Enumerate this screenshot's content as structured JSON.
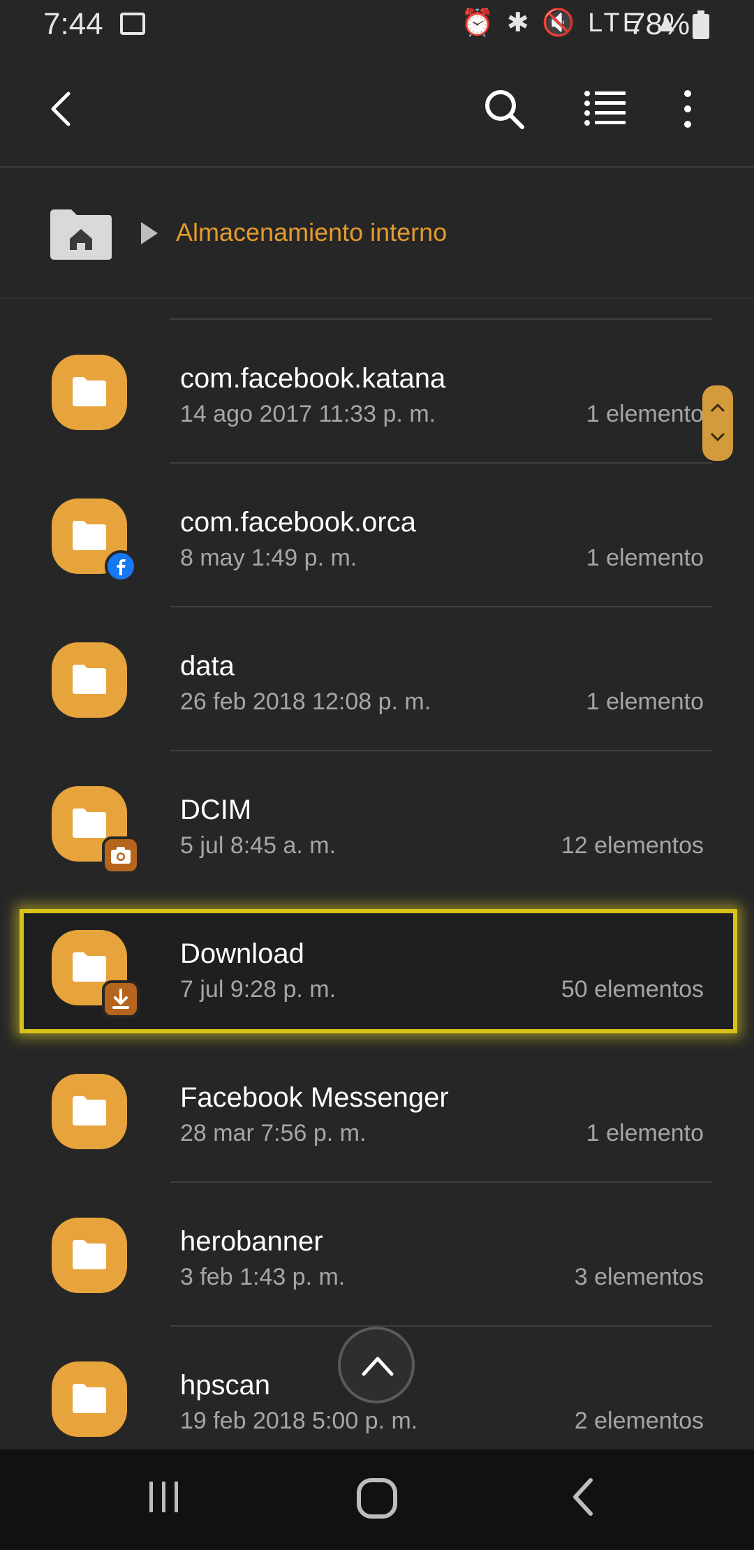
{
  "status_bar": {
    "time": "7:44",
    "status_icons": "⏰ ✱ 🔇 LTE ▲",
    "battery": "78%"
  },
  "app_bar": {
    "back_icon": "back-arrow-icon",
    "search_icon": "search-icon",
    "list_view_icon": "list-view-icon",
    "more_icon": "more-vert-icon"
  },
  "breadcrumb": {
    "home_icon": "home-folder-icon",
    "current": "Almacenamiento interno"
  },
  "colors": {
    "accent": "#e39b2e",
    "folder": "#e8a43c",
    "highlight": "#d8c21a",
    "background": "#262626"
  },
  "folders": [
    {
      "name": "com.facebook.katana",
      "date": "14 ago 2017 11:33 p. m.",
      "count": "1 elemento",
      "badge": null
    },
    {
      "name": "com.facebook.orca",
      "date": "8 may 1:49 p. m.",
      "count": "1 elemento",
      "badge": "facebook-icon"
    },
    {
      "name": "data",
      "date": "26 feb 2018 12:08 p. m.",
      "count": "1 elemento",
      "badge": null
    },
    {
      "name": "DCIM",
      "date": "5 jul 8:45 a. m.",
      "count": "12 elementos",
      "badge": "camera-icon"
    },
    {
      "name": "Download",
      "date": "7 jul 9:28 p. m.",
      "count": "50 elementos",
      "badge": "download-icon",
      "highlighted": true
    },
    {
      "name": "Facebook Messenger",
      "date": "28 mar 7:56 p. m.",
      "count": "1 elemento",
      "badge": null
    },
    {
      "name": "herobanner",
      "date": "3 feb 1:43 p. m.",
      "count": "3 elementos",
      "badge": null
    },
    {
      "name": "hpscan",
      "date": "19 feb 2018 5:00 p. m.",
      "count": "2 elementos",
      "badge": null
    }
  ],
  "nav_bar": {
    "recent_icon": "recent-apps-icon",
    "home_icon": "home-icon",
    "back_icon": "back-icon"
  }
}
